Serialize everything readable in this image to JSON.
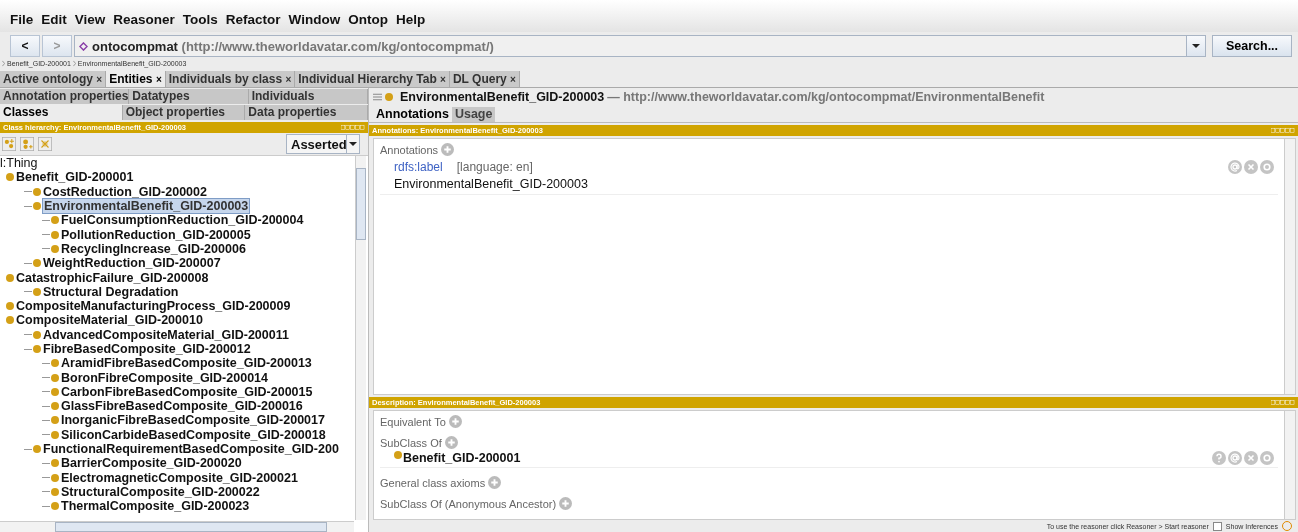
{
  "menu": [
    "File",
    "Edit",
    "View",
    "Reasoner",
    "Tools",
    "Refactor",
    "Window",
    "Ontop",
    "Help"
  ],
  "nav": {
    "back": "<",
    "forward": ">",
    "ontology": "ontocompmat",
    "iri": "(http://www.theworldavatar.com/kg/ontocompmat/)",
    "search": "Search..."
  },
  "breadcrumbs": [
    "Benefit_GID-200001",
    "EnvironmentalBenefit_GID-200003"
  ],
  "tabs": [
    {
      "label": "Active ontology",
      "close": "×",
      "selected": false
    },
    {
      "label": "Entities",
      "close": "×",
      "selected": true
    },
    {
      "label": "Individuals by class",
      "close": "×",
      "selected": false
    },
    {
      "label": "Individual Hierarchy Tab",
      "close": "×",
      "selected": false
    },
    {
      "label": "DL Query",
      "close": "×",
      "selected": false
    }
  ],
  "entity_tabs": [
    [
      {
        "label": "Annotation properties",
        "selected": false
      },
      {
        "label": "Datatypes",
        "selected": false
      },
      {
        "label": "Individuals",
        "selected": false
      }
    ],
    [
      {
        "label": "Classes",
        "selected": true
      },
      {
        "label": "Object properties",
        "selected": false
      },
      {
        "label": "Data properties",
        "selected": false
      }
    ]
  ],
  "class_hierarchy": {
    "header": "Class hierarchy: EnvironmentalBenefit_GID-200003",
    "mode": "Asserted",
    "tree": {
      "label": "l:Thing",
      "selected": false,
      "children": [
        {
          "label": "Benefit_GID-200001",
          "selected": false,
          "children": [
            {
              "label": "CostReduction_GID-200002",
              "selected": false
            },
            {
              "label": "EnvironmentalBenefit_GID-200003",
              "selected": true,
              "children": [
                {
                  "label": "FuelConsumptionReduction_GID-200004",
                  "selected": false
                },
                {
                  "label": "PollutionReduction_GID-200005",
                  "selected": false
                },
                {
                  "label": "RecyclingIncrease_GID-200006",
                  "selected": false
                }
              ]
            },
            {
              "label": "WeightReduction_GID-200007",
              "selected": false
            }
          ]
        },
        {
          "label": "CatastrophicFailure_GID-200008",
          "selected": false,
          "children": [
            {
              "label": "Structural Degradation",
              "selected": false
            }
          ]
        },
        {
          "label": "CompositeManufacturingProcess_GID-200009",
          "selected": false
        },
        {
          "label": "CompositeMaterial_GID-200010",
          "selected": false,
          "children": [
            {
              "label": "AdvancedCompositeMaterial_GID-200011",
              "selected": false
            },
            {
              "label": "FibreBasedComposite_GID-200012",
              "selected": false,
              "children": [
                {
                  "label": "AramidFibreBasedComposite_GID-200013",
                  "selected": false
                },
                {
                  "label": "BoronFibreComposite_GID-200014",
                  "selected": false
                },
                {
                  "label": "CarbonFibreBasedComposite_GID-200015",
                  "selected": false
                },
                {
                  "label": "GlassFibreBasedComposite_GID-200016",
                  "selected": false
                },
                {
                  "label": "InorganicFibreBasedComposite_GID-200017",
                  "selected": false
                },
                {
                  "label": "SiliconCarbideBasedComposite_GID-200018",
                  "selected": false
                }
              ]
            },
            {
              "label": "FunctionalRequirementBasedComposite_GID-200",
              "selected": false,
              "children": [
                {
                  "label": "BarrierComposite_GID-200020",
                  "selected": false
                },
                {
                  "label": "ElectromagneticComposite_GID-200021",
                  "selected": false
                },
                {
                  "label": "StructuralComposite_GID-200022",
                  "selected": false
                },
                {
                  "label": "ThermalComposite_GID-200023",
                  "selected": false
                }
              ]
            }
          ]
        }
      ]
    }
  },
  "entity": {
    "name": "EnvironmentalBenefit_GID-200003",
    "iri": "— http://www.theworldavatar.com/kg/ontocompmat/EnvironmentalBenefit"
  },
  "right_tabs": [
    {
      "label": "Annotations",
      "selected": true
    },
    {
      "label": "Usage",
      "selected": false
    }
  ],
  "annotations": {
    "header": "Annotations: EnvironmentalBenefit_GID-200003",
    "section": "Annotations",
    "property": "rdfs:label",
    "language": "[language: en]",
    "value": "EnvironmentalBenefit_GID-200003"
  },
  "description": {
    "header": "Description: EnvironmentalBenefit_GID-200003",
    "sections": [
      {
        "title": "Equivalent To"
      },
      {
        "title": "SubClass Of",
        "items": [
          "Benefit_GID-200001"
        ]
      },
      {
        "title": "General class axioms"
      },
      {
        "title": "SubClass Of (Anonymous Ancestor)"
      }
    ]
  },
  "status": {
    "message": "To use the reasoner click Reasoner > Start reasoner",
    "show_inferences": "Show Inferences",
    "checked": false
  }
}
